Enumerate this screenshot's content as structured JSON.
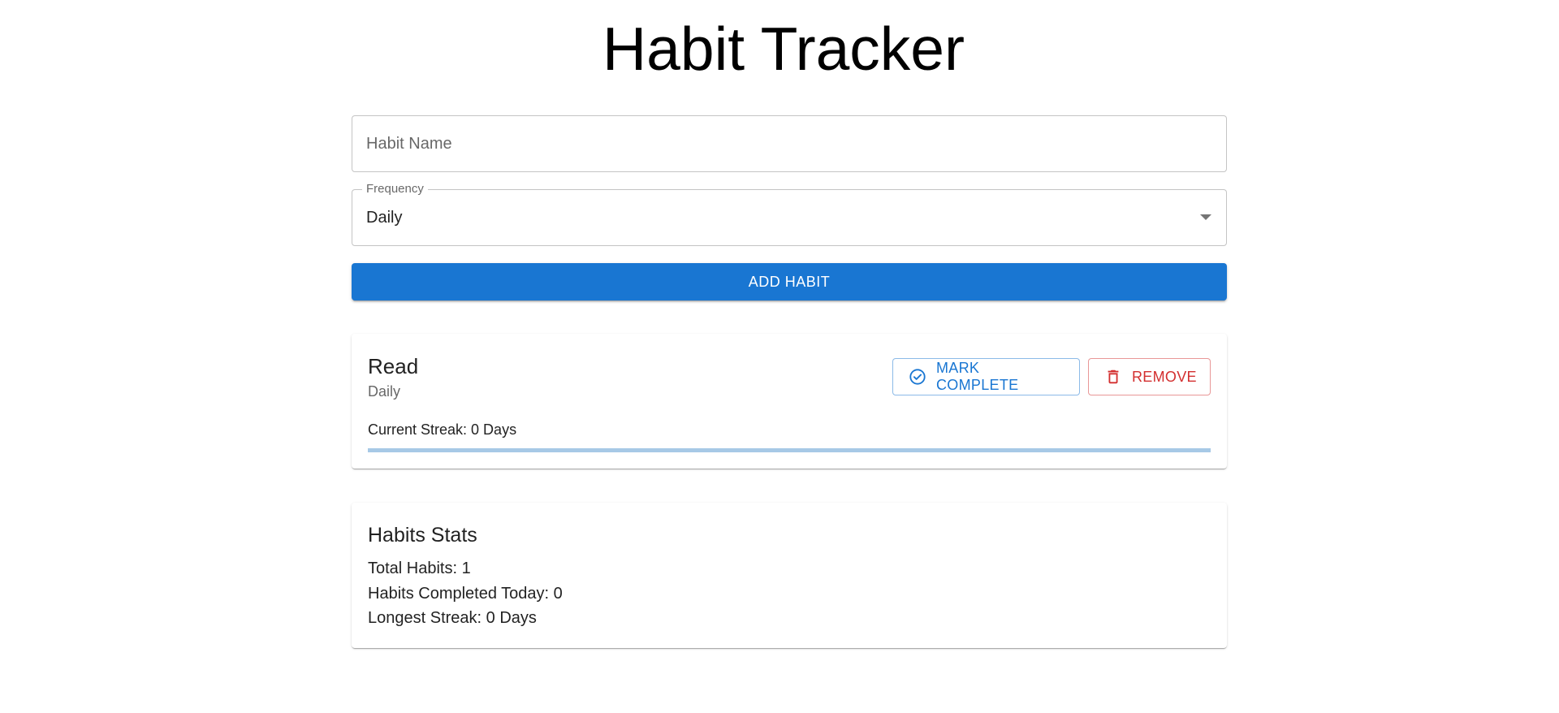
{
  "header": {
    "title": "Habit Tracker"
  },
  "form": {
    "habit_name": {
      "placeholder": "Habit Name",
      "value": ""
    },
    "frequency": {
      "label": "Frequency",
      "selected": "Daily"
    },
    "add_button_label": "ADD HABIT"
  },
  "habits": [
    {
      "name": "Read",
      "frequency": "Daily",
      "streak_text": "Current Streak: 0 Days",
      "progress_percent": 0,
      "mark_complete_label": "MARK COMPLETE",
      "remove_label": "REMOVE"
    }
  ],
  "stats": {
    "title": "Habits Stats",
    "total_habits": "Total Habits: 1",
    "completed_today": "Habits Completed Today: 0",
    "longest_streak": "Longest Streak: 0 Days"
  },
  "colors": {
    "primary": "#1976d2",
    "error": "#d32f2f",
    "progress_track": "#a7c9e6"
  },
  "icons": {
    "mark_complete": "check-circle-outline-icon",
    "remove": "trash-icon",
    "select_caret": "arrow-drop-down-icon"
  }
}
